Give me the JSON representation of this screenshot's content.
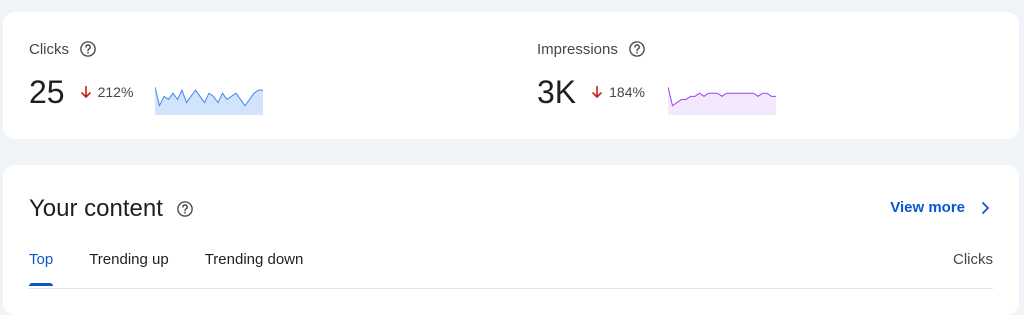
{
  "stats": {
    "clicks": {
      "label": "Clicks",
      "value": "25",
      "change": "212%",
      "direction": "down",
      "sparkline_color": "#4285f4",
      "sparkline_fill": "#d2e3fc",
      "sparkline": [
        9,
        3,
        6,
        5,
        7,
        5,
        8,
        4,
        6,
        8,
        6,
        4,
        7,
        6,
        4,
        7,
        5,
        6,
        7,
        5,
        3,
        5,
        7,
        8,
        8
      ]
    },
    "impressions": {
      "label": "Impressions",
      "value": "3K",
      "change": "184%",
      "direction": "down",
      "sparkline_color": "#a142f4",
      "sparkline_fill": "#f3e8fd",
      "sparkline": [
        9,
        3,
        4,
        5,
        5,
        6,
        6,
        7,
        6,
        7,
        7,
        7,
        6,
        7,
        7,
        7,
        7,
        7,
        7,
        7,
        6,
        7,
        7,
        6,
        6
      ]
    },
    "trend_color": "#c5221f"
  },
  "content": {
    "title": "Your content",
    "view_more": "View more",
    "tabs": [
      {
        "label": "Top",
        "active": true
      },
      {
        "label": "Trending up",
        "active": false
      },
      {
        "label": "Trending down",
        "active": false
      }
    ],
    "column_header": "Clicks"
  },
  "colors": {
    "accent": "#0b57d0",
    "page_bg": "#f0f4f9",
    "card_bg": "#ffffff"
  }
}
